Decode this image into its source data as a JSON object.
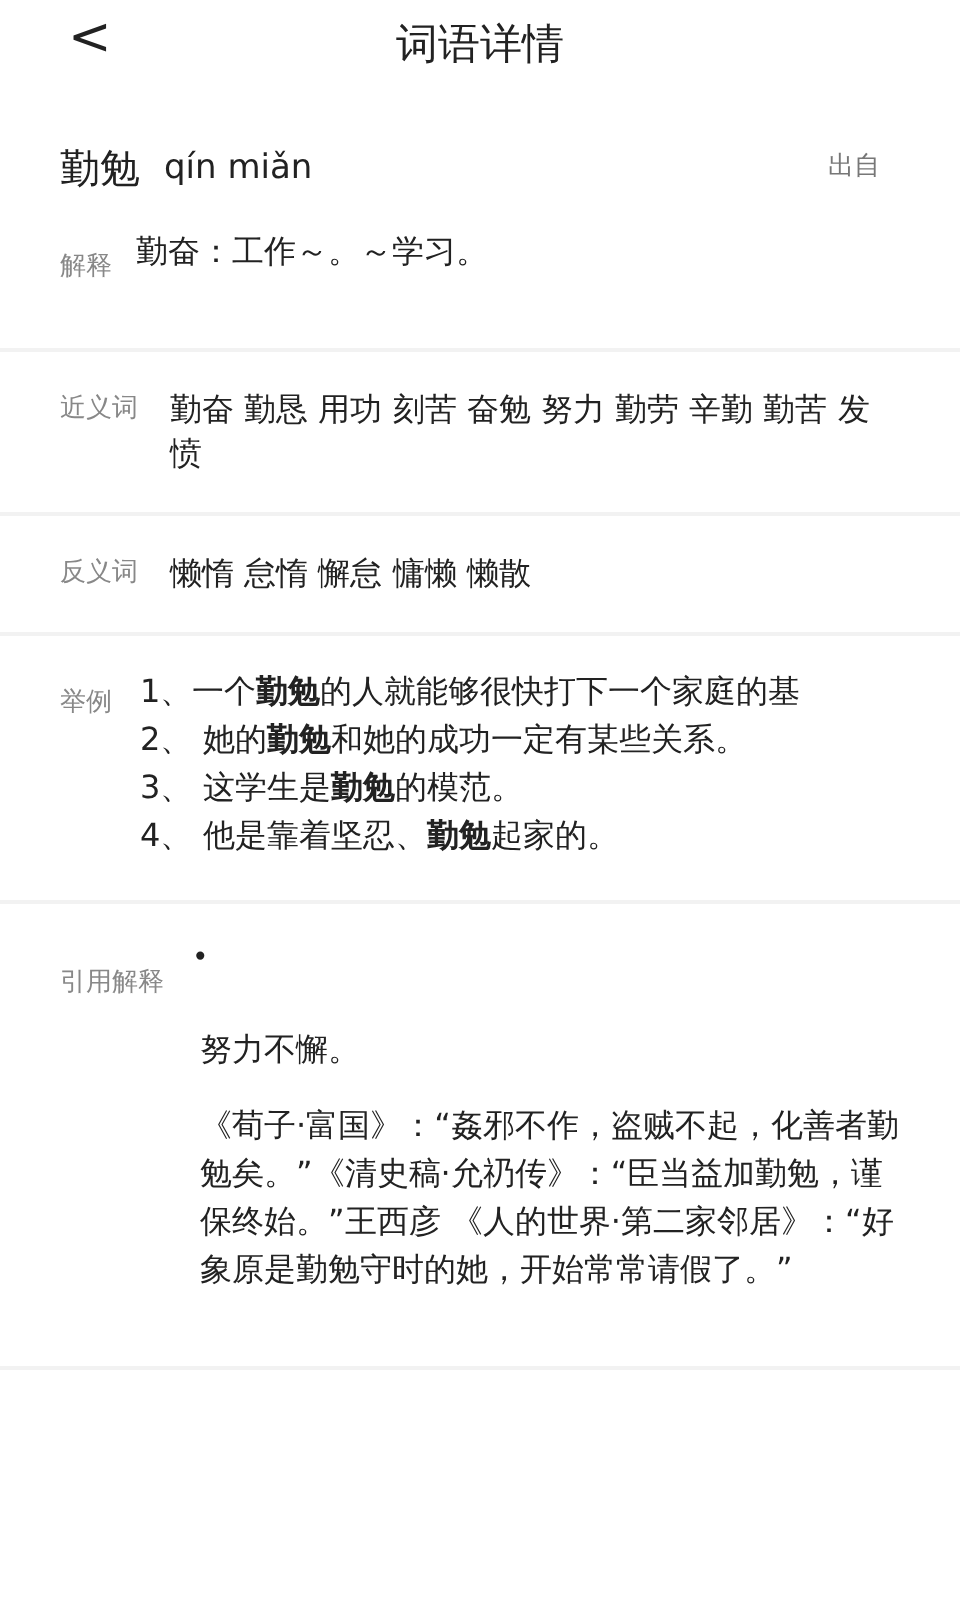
{
  "header": {
    "back": "<",
    "title": "词语详情"
  },
  "word": {
    "text": "勤勉",
    "pinyin": "qín miǎn",
    "source_link": "出自"
  },
  "sections": [
    {
      "kind": "text",
      "label": "解释",
      "text": "勤奋：工作～。～学习。"
    },
    {
      "kind": "words",
      "label": "近义词",
      "text": "勤奋 勤恳 用功 刻苦 奋勉 努力 勤劳 辛勤 勤苦 发愤"
    },
    {
      "kind": "words",
      "label": "反义词",
      "text": "懒惰 怠惰 懈怠 慵懒 懒散"
    },
    {
      "kind": "examples",
      "label": "举例",
      "items": [
        "1、一个**勤勉**的人就能够很快打下一个家庭的基",
        "2、 她的**勤勉**和她的成功一定有某些关系。",
        "3、 这学生是**勤勉**的模范。",
        "4、 他是靠着坚忍、**勤勉**起家的。"
      ]
    },
    {
      "kind": "citation",
      "label": "引用解释",
      "bullet": "•",
      "meaning": "努力不懈。",
      "quote": "《荀子·富国》：“姦邪不作，盗贼不起，化善者勤勉矣。”《清史稿·允礽传》：“臣当益加勤勉，谨保终始。”王西彦 《人的世界·第二家邻居》：“好象原是勤勉守时的她，开始常常请假了。”"
    }
  ]
}
